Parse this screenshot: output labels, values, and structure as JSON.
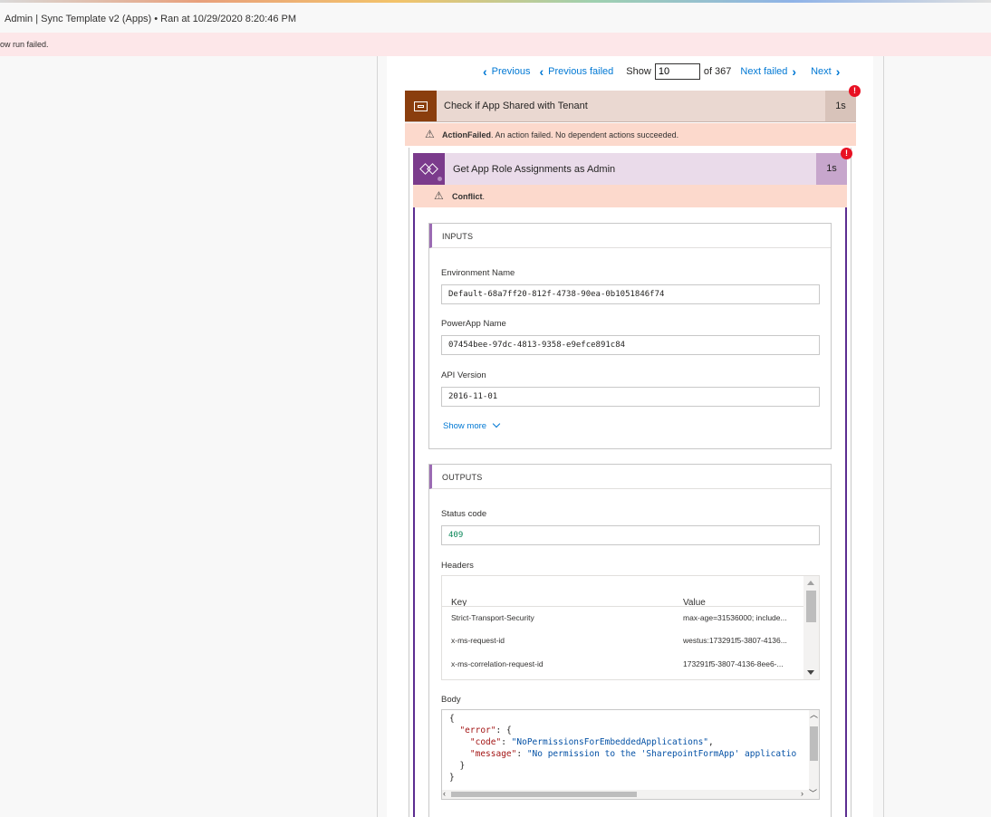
{
  "header": {
    "title": "Admin | Sync Template v2 (Apps) • Ran at 10/29/2020 8:20:46 PM",
    "failure_text": "ow run failed."
  },
  "pager": {
    "previous": "Previous",
    "previous_failed": "Previous failed",
    "show_label": "Show",
    "show_value": "10",
    "of_text": "of 367",
    "next_failed": "Next failed",
    "next": "Next"
  },
  "actions": [
    {
      "name": "Check if App Shared with Tenant",
      "duration": "1s",
      "message_bold": "ActionFailed",
      "message": ". An action failed. No dependent actions succeeded.",
      "status": "failed",
      "color": "#8a3e0e"
    },
    {
      "name": "Get App Role Assignments as Admin",
      "duration": "1s",
      "message_bold": "Conflict",
      "message": ".",
      "status": "failed",
      "color": "#7b3b8c"
    }
  ],
  "inputs": {
    "title": "INPUTS",
    "fields": [
      {
        "label": "Environment Name",
        "value": "Default-68a7ff20-812f-4738-90ea-0b1051846f74"
      },
      {
        "label": "PowerApp Name",
        "value": "07454bee-97dc-4813-9358-e9efce891c84"
      },
      {
        "label": "API Version",
        "value": "2016-11-01"
      }
    ],
    "show_more": "Show more"
  },
  "outputs": {
    "title": "OUTPUTS",
    "status_label": "Status code",
    "status_value": "409",
    "headers_label": "Headers",
    "headers_columns": [
      "Key",
      "Value"
    ],
    "headers_rows": [
      {
        "key": "Strict-Transport-Security",
        "value": "max-age=31536000; include..."
      },
      {
        "key": "x-ms-request-id",
        "value": "westus:173291f5-3807-4136..."
      },
      {
        "key": "x-ms-correlation-request-id",
        "value": "173291f5-3807-4136-8ee6-..."
      }
    ],
    "body_label": "Body",
    "body": {
      "open": "{",
      "error_key": "\"error\"",
      "code_key": "\"code\"",
      "code_value": "\"NoPermissionsForEmbeddedApplications\"",
      "message_key": "\"message\"",
      "message_value": "\"No permission to the 'SharepointFormApp' applicatio",
      "inner_close": "}",
      "close": "}"
    }
  }
}
